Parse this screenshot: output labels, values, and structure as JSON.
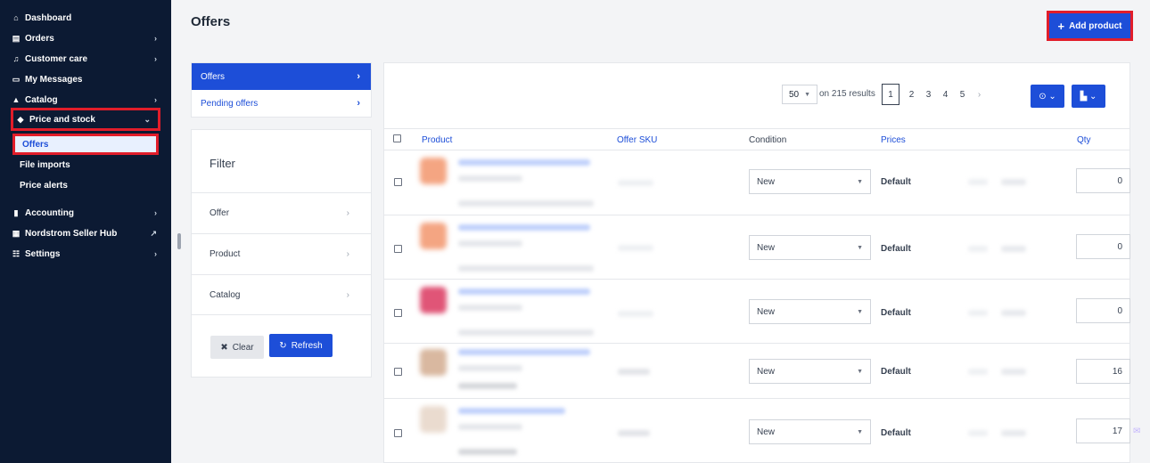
{
  "sidebar": {
    "items": [
      {
        "label": "Dashboard",
        "icon": "home-icon",
        "glyph": "⌂",
        "chevron": ""
      },
      {
        "label": "Orders",
        "icon": "orders-icon",
        "glyph": "▤",
        "chevron": "›"
      },
      {
        "label": "Customer care",
        "icon": "headset-icon",
        "glyph": "♫",
        "chevron": "›"
      },
      {
        "label": "My Messages",
        "icon": "message-icon",
        "glyph": "▭",
        "chevron": ""
      },
      {
        "label": "Catalog",
        "icon": "catalog-icon",
        "glyph": "▲",
        "chevron": "›"
      },
      {
        "label": "Price and stock",
        "icon": "tag-icon",
        "glyph": "◆",
        "chevron": "⌄"
      },
      {
        "label": "Accounting",
        "icon": "accounting-icon",
        "glyph": "▮",
        "chevron": "›"
      },
      {
        "label": "Nordstrom Seller Hub",
        "icon": "grid-icon",
        "glyph": "▦",
        "chevron": "↗"
      },
      {
        "label": "Settings",
        "icon": "settings-icon",
        "glyph": "☷",
        "chevron": "›"
      }
    ],
    "sub_items": [
      "Offers",
      "File imports",
      "Price alerts"
    ]
  },
  "header": {
    "title": "Offers",
    "add_button": "Add product"
  },
  "tabs": [
    {
      "label": "Offers"
    },
    {
      "label": "Pending offers"
    }
  ],
  "filter": {
    "title": "Filter",
    "rows": [
      "Offer",
      "Product",
      "Catalog"
    ],
    "clear": "Clear",
    "refresh": "Refresh"
  },
  "toolbar": {
    "per_page": "50",
    "results": "on 215 results",
    "pages": [
      "1",
      "2",
      "3",
      "4",
      "5",
      "›"
    ]
  },
  "columns": {
    "product": "Product",
    "offer_sku": "Offer SKU",
    "condition": "Condition",
    "prices": "Prices",
    "qty": "Qty"
  },
  "rows": [
    {
      "condition": "New",
      "price_label": "Default",
      "qty": "0",
      "thumb_color": "#f4a582"
    },
    {
      "condition": "New",
      "price_label": "Default",
      "qty": "0",
      "thumb_color": "#f4a582"
    },
    {
      "condition": "New",
      "price_label": "Default",
      "qty": "0",
      "thumb_color": "#e05577"
    },
    {
      "condition": "New",
      "price_label": "Default",
      "qty": "16",
      "thumb_color": "#d9b8a0"
    },
    {
      "condition": "New",
      "price_label": "Default",
      "qty": "17",
      "thumb_color": "#eadbcf"
    }
  ],
  "colors": {
    "sidebar_bg": "#0c1a33",
    "accent": "#1d4ed8",
    "highlight_border": "#e11d2a"
  }
}
